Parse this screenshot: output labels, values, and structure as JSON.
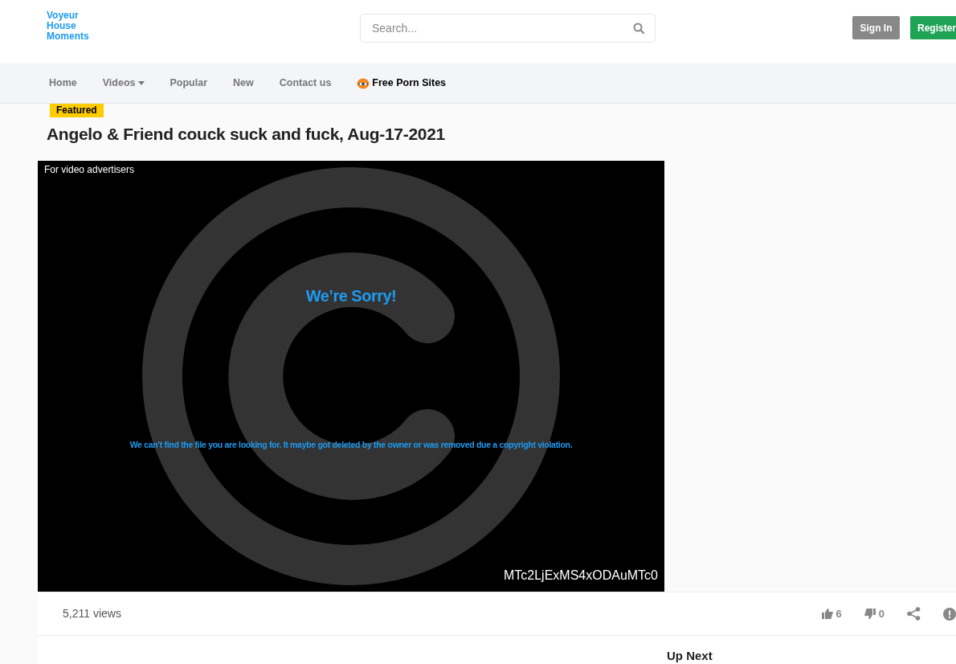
{
  "logo": {
    "lines": [
      "Voyeur",
      "House",
      "Moments"
    ]
  },
  "search": {
    "placeholder": "Search..."
  },
  "auth_buttons": [
    {
      "label": "Sign In",
      "kind": "signin"
    },
    {
      "label": "Register",
      "kind": "register"
    }
  ],
  "nav": [
    {
      "label": "Home",
      "kind": "link"
    },
    {
      "label": "Videos",
      "kind": "dropdown"
    },
    {
      "label": "Popular",
      "kind": "link"
    },
    {
      "label": "New",
      "kind": "link"
    },
    {
      "label": "Contact us",
      "kind": "link"
    },
    {
      "label": "Free Porn Sites",
      "kind": "promo"
    }
  ],
  "badge": "Featured",
  "title": "Angelo & Friend couck suck and fuck, Aug-17-2021",
  "player": {
    "corner_label": "For video advertisers",
    "heading": "We’re Sorry!",
    "message": "We can't find the file you are looking for. It maybe got deleted by the owner or was removed due a copyright violation.",
    "code": "MTc2LjExMS4xODAuMTc0"
  },
  "views": "5,211 views",
  "actions": [
    {
      "kind": "like",
      "count": "6"
    },
    {
      "kind": "dislike",
      "count": "0"
    },
    {
      "kind": "share"
    },
    {
      "kind": "report"
    }
  ],
  "up_next": "Up Next"
}
